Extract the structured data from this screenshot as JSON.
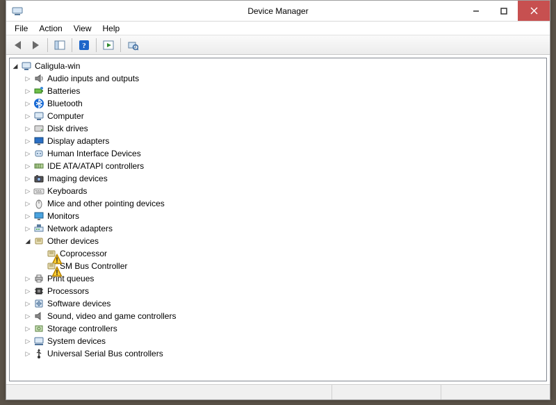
{
  "window": {
    "title": "Device Manager"
  },
  "menu": {
    "file": "File",
    "action": "Action",
    "view": "View",
    "help": "Help"
  },
  "toolbar": {
    "back": "back",
    "forward": "forward",
    "show_hide": "show-hide-console-tree",
    "help": "help",
    "action": "action",
    "scan": "scan-for-hardware-changes"
  },
  "tree": {
    "root": {
      "label": "Caligula-win",
      "icon": "computer-icon",
      "expanded": true,
      "children": [
        {
          "label": "Audio inputs and outputs",
          "icon": "speaker-icon",
          "expandable": true
        },
        {
          "label": "Batteries",
          "icon": "battery-icon",
          "expandable": true
        },
        {
          "label": "Bluetooth",
          "icon": "bluetooth-icon",
          "expandable": true
        },
        {
          "label": "Computer",
          "icon": "computer-icon",
          "expandable": true
        },
        {
          "label": "Disk drives",
          "icon": "disk-icon",
          "expandable": true
        },
        {
          "label": "Display adapters",
          "icon": "display-icon",
          "expandable": true
        },
        {
          "label": "Human Interface Devices",
          "icon": "hid-icon",
          "expandable": true
        },
        {
          "label": "IDE ATA/ATAPI controllers",
          "icon": "ide-icon",
          "expandable": true
        },
        {
          "label": "Imaging devices",
          "icon": "imaging-icon",
          "expandable": true
        },
        {
          "label": "Keyboards",
          "icon": "keyboard-icon",
          "expandable": true
        },
        {
          "label": "Mice and other pointing devices",
          "icon": "mouse-icon",
          "expandable": true
        },
        {
          "label": "Monitors",
          "icon": "monitor-icon",
          "expandable": true
        },
        {
          "label": "Network adapters",
          "icon": "network-icon",
          "expandable": true
        },
        {
          "label": "Other devices",
          "icon": "other-icon",
          "expandable": true,
          "expanded": true,
          "children": [
            {
              "label": "Coprocessor",
              "icon": "other-icon",
              "warn": true
            },
            {
              "label": "SM Bus Controller",
              "icon": "other-icon",
              "warn": true
            }
          ]
        },
        {
          "label": "Print queues",
          "icon": "printer-icon",
          "expandable": true
        },
        {
          "label": "Processors",
          "icon": "processor-icon",
          "expandable": true
        },
        {
          "label": "Software devices",
          "icon": "software-icon",
          "expandable": true
        },
        {
          "label": "Sound, video and game controllers",
          "icon": "sound-icon",
          "expandable": true
        },
        {
          "label": "Storage controllers",
          "icon": "storage-icon",
          "expandable": true
        },
        {
          "label": "System devices",
          "icon": "system-icon",
          "expandable": true
        },
        {
          "label": "Universal Serial Bus controllers",
          "icon": "usb-icon",
          "expandable": true
        }
      ]
    }
  }
}
